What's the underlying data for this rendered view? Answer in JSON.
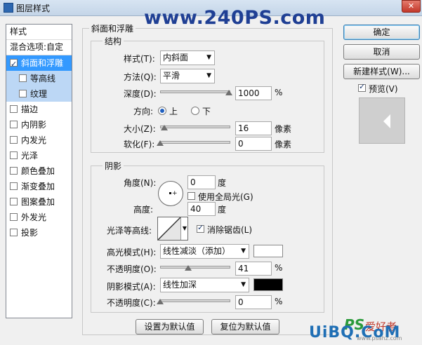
{
  "window": {
    "title": "图层样式",
    "watermark": "www.240PS.com",
    "close_glyph": "✕"
  },
  "left_panel": {
    "header": "样式",
    "blend_options": "混合选项:自定",
    "items": [
      {
        "label": "斜面和浮雕",
        "checked": true,
        "selected": true
      },
      {
        "label": "等高线",
        "checked": false,
        "sub": true
      },
      {
        "label": "纹理",
        "checked": false,
        "sub": true
      },
      {
        "label": "描边",
        "checked": false
      },
      {
        "label": "内阴影",
        "checked": false
      },
      {
        "label": "内发光",
        "checked": false
      },
      {
        "label": "光泽",
        "checked": false
      },
      {
        "label": "颜色叠加",
        "checked": false
      },
      {
        "label": "渐变叠加",
        "checked": false
      },
      {
        "label": "图案叠加",
        "checked": false
      },
      {
        "label": "外发光",
        "checked": false
      },
      {
        "label": "投影",
        "checked": false
      }
    ]
  },
  "bevel": {
    "group_title": "斜面和浮雕",
    "structure_title": "结构",
    "style_label": "样式(T):",
    "style_value": "内斜面",
    "technique_label": "方法(Q):",
    "technique_value": "平滑",
    "depth_label": "深度(D):",
    "depth_value": "1000",
    "depth_unit": "%",
    "depth_level": 1.0,
    "direction_label": "方向:",
    "dir_up": "上",
    "dir_down": "下",
    "direction": "up",
    "size_label": "大小(Z):",
    "size_value": "16",
    "size_unit": "像素",
    "size_level": 0.06,
    "soften_label": "软化(F):",
    "soften_value": "0",
    "soften_unit": "像素",
    "soften_level": 0.0
  },
  "shading": {
    "title": "阴影",
    "angle_label": "角度(N):",
    "angle_value": "0",
    "angle_unit": "度",
    "global_light_label": "使用全局光(G)",
    "global_light": false,
    "altitude_label": "高度:",
    "altitude_value": "40",
    "altitude_unit": "度",
    "gloss_label": "光泽等高线:",
    "antialias_label": "消除锯齿(L)",
    "antialias": true,
    "highlight_label": "高光模式(H):",
    "highlight_mode": "线性减淡（添加）",
    "highlight_color": "#ffffff",
    "hl_opacity_label": "不透明度(O):",
    "hl_opacity_value": "41",
    "hl_opacity_unit": "%",
    "hl_opacity_level": 0.41,
    "shadow_label": "阴影模式(A):",
    "shadow_mode": "线性加深",
    "shadow_color": "#000000",
    "sh_opacity_label": "不透明度(C):",
    "sh_opacity_value": "0",
    "sh_opacity_unit": "%",
    "sh_opacity_level": 0.0
  },
  "buttons": {
    "ok": "确定",
    "cancel": "取消",
    "new_style": "新建样式(W)...",
    "preview_label": "预览(V)",
    "preview": true,
    "make_default": "设置为默认值",
    "reset_default": "复位为默认值"
  },
  "footer": {
    "logo_text": "UiBQ.CoM",
    "ps_text": "PS",
    "cn_text": "爱好者",
    "url": "www.psahz.com"
  },
  "colors": {
    "selection": "#3399ff",
    "sub_selection": "#bcd7f5",
    "watermark": "#1f3f94"
  }
}
